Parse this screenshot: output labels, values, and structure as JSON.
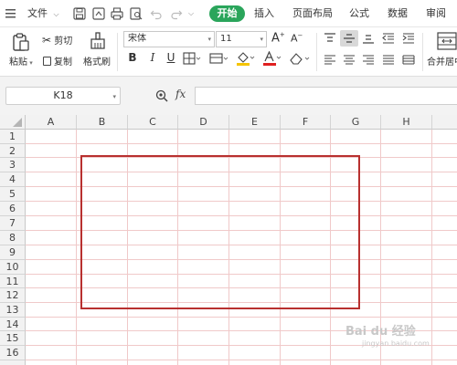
{
  "menubar": {
    "file_label": "文件",
    "tabs": [
      "开始",
      "插入",
      "页面布局",
      "公式",
      "数据",
      "审阅"
    ]
  },
  "ribbon": {
    "paste_label": "粘贴",
    "cut_label": "剪切",
    "copy_label": "复制",
    "format_painter_label": "格式刷",
    "font_name": "宋体",
    "font_size": "11",
    "bold_label": "B",
    "italic_label": "I",
    "underline_label": "U",
    "merge_label": "合并居中"
  },
  "formula_bar": {
    "cell_ref": "K18",
    "fx_label": "fx",
    "formula_value": ""
  },
  "sheet": {
    "columns": [
      "A",
      "B",
      "C",
      "D",
      "E",
      "F",
      "G",
      "H"
    ],
    "rows": [
      "1",
      "2",
      "3",
      "4",
      "5",
      "6",
      "7",
      "8",
      "9",
      "10",
      "11",
      "12",
      "13",
      "14",
      "15",
      "16"
    ],
    "gridline_color": "#f0c9c9",
    "border_box_color": "#b8302f"
  },
  "watermark": {
    "text": "Bai du 经验",
    "sub": "jingyan.baidu.com"
  }
}
